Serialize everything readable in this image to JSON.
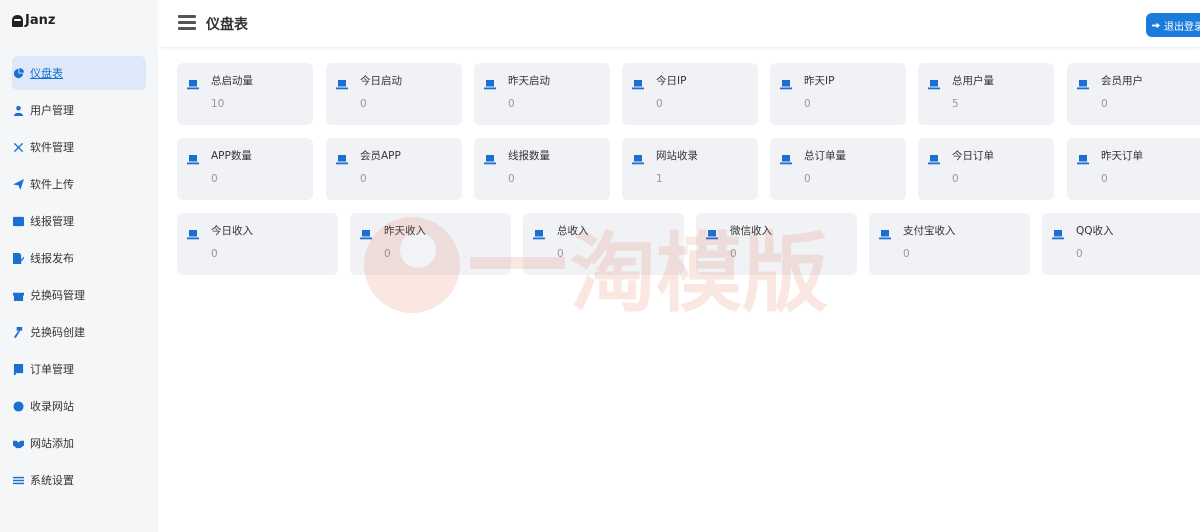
{
  "sidebar": {
    "brand": "Janz",
    "items": [
      {
        "label": "仪盘表",
        "icon": "pie-chart-icon",
        "active": true
      },
      {
        "label": "用户管理",
        "icon": "user-icon"
      },
      {
        "label": "软件管理",
        "icon": "tools-icon"
      },
      {
        "label": "软件上传",
        "icon": "send-icon"
      },
      {
        "label": "线报管理",
        "icon": "list-icon"
      },
      {
        "label": "线报发布",
        "icon": "edit-doc-icon"
      },
      {
        "label": "兑换码管理",
        "icon": "gift-icon"
      },
      {
        "label": "兑换码创建",
        "icon": "hammer-icon"
      },
      {
        "label": "订单管理",
        "icon": "scroll-icon"
      },
      {
        "label": "收录网站",
        "icon": "smile-icon"
      },
      {
        "label": "网站添加",
        "icon": "handshake-icon"
      },
      {
        "label": "系统设置",
        "icon": "sliders-icon"
      }
    ]
  },
  "header": {
    "title": "仪盘表",
    "logout_label": "退出登录"
  },
  "stats": {
    "row1": [
      {
        "label": "总启动量",
        "value": "10"
      },
      {
        "label": "今日启动",
        "value": "0"
      },
      {
        "label": "昨天启动",
        "value": "0"
      },
      {
        "label": "今日IP",
        "value": "0"
      },
      {
        "label": "昨天IP",
        "value": "0"
      },
      {
        "label": "总用户量",
        "value": "5"
      },
      {
        "label": "会员用户",
        "value": "0"
      }
    ],
    "row2": [
      {
        "label": "APP数量",
        "value": "0"
      },
      {
        "label": "会员APP",
        "value": "0"
      },
      {
        "label": "线报数量",
        "value": "0"
      },
      {
        "label": "网站收录",
        "value": "1"
      },
      {
        "label": "总订单量",
        "value": "0"
      },
      {
        "label": "今日订单",
        "value": "0"
      },
      {
        "label": "昨天订单",
        "value": "0"
      }
    ],
    "row3": [
      {
        "label": "今日收入",
        "value": "0"
      },
      {
        "label": "昨天收入",
        "value": "0"
      },
      {
        "label": "总收入",
        "value": "0"
      },
      {
        "label": "微信收入",
        "value": "0"
      },
      {
        "label": "支付宝收入",
        "value": "0"
      },
      {
        "label": "QQ收入",
        "value": "0"
      }
    ]
  },
  "colors": {
    "accent": "#1a6fd1",
    "card_bg": "#f0f2f5",
    "sidebar_bg": "#f5f6f8",
    "watermark": "#e0502a"
  },
  "watermark_text": "淘模版"
}
